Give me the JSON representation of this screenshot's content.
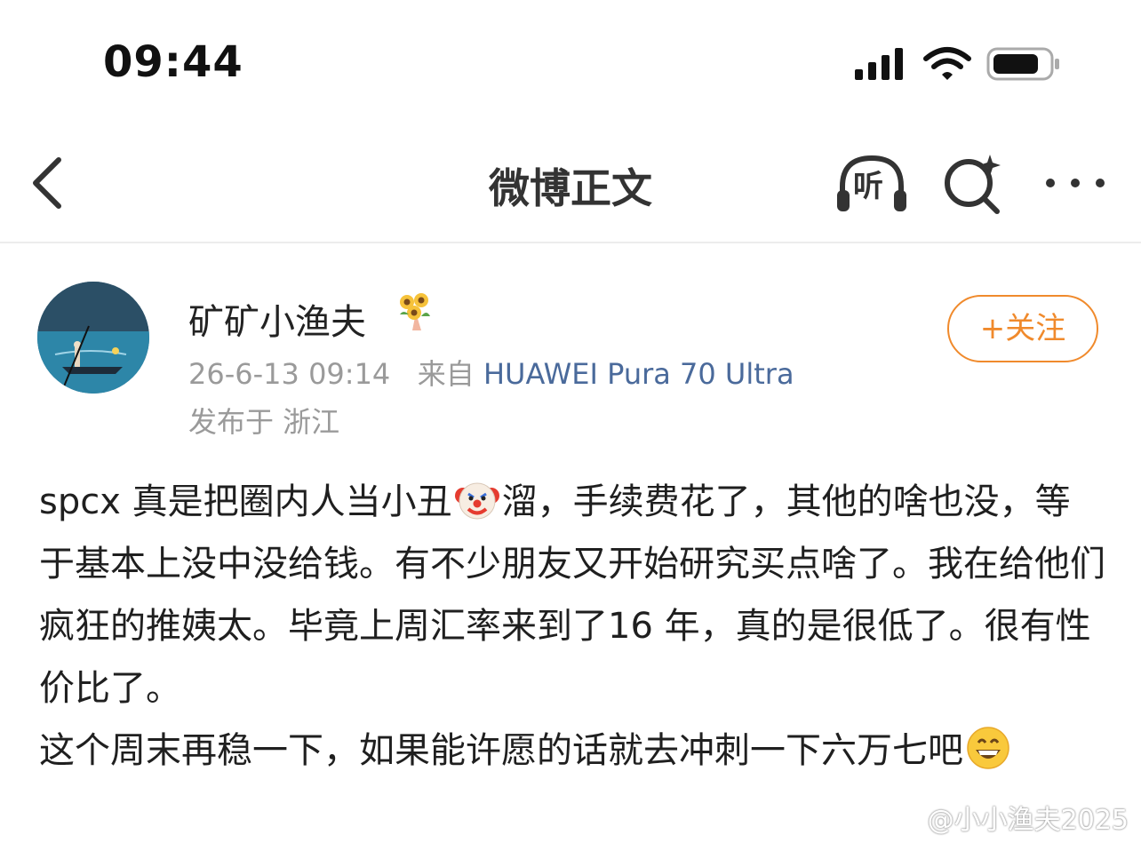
{
  "status_bar": {
    "time": "09:44",
    "icons": [
      "cellular-signal-icon",
      "wifi-icon",
      "battery-icon"
    ]
  },
  "nav": {
    "title": "微博正文",
    "listen_label": "听",
    "icons": [
      "chevron-left-icon",
      "headphones-icon",
      "search-sparkle-icon",
      "more-icon"
    ]
  },
  "post": {
    "author": "矿矿小渔夫",
    "author_badge": "sunflower-bouquet-icon",
    "timestamp": "26-6-13 09:14",
    "source_prefix": "来自",
    "device": "HUAWEI Pura 70 Ultra",
    "location": "发布于 浙江",
    "follow_label": "+关注",
    "paragraphs": [
      {
        "before_emoji": "spcx 真是把圈内人当小丑",
        "emoji": "clown-face-icon",
        "after_emoji": "溜，手续费花了，其他的啥也没，等于基本上没中没给钱。有不少朋友又开始研究买点啥了。我在给他们疯狂的推姨太。毕竟上周汇率来到了16 年，真的是很低了。很有性价比了。"
      },
      {
        "before_emoji": "这个周末再稳一下，如果能许愿的话就去冲刺一下六万七吧",
        "emoji": "grinning-face-icon",
        "after_emoji": ""
      }
    ]
  },
  "watermark": "@小小渔夫2025",
  "colors": {
    "accent": "#f08a2c",
    "device_link": "#4a6a9b",
    "meta": "#9a9a9a",
    "divider": "#ececec"
  }
}
